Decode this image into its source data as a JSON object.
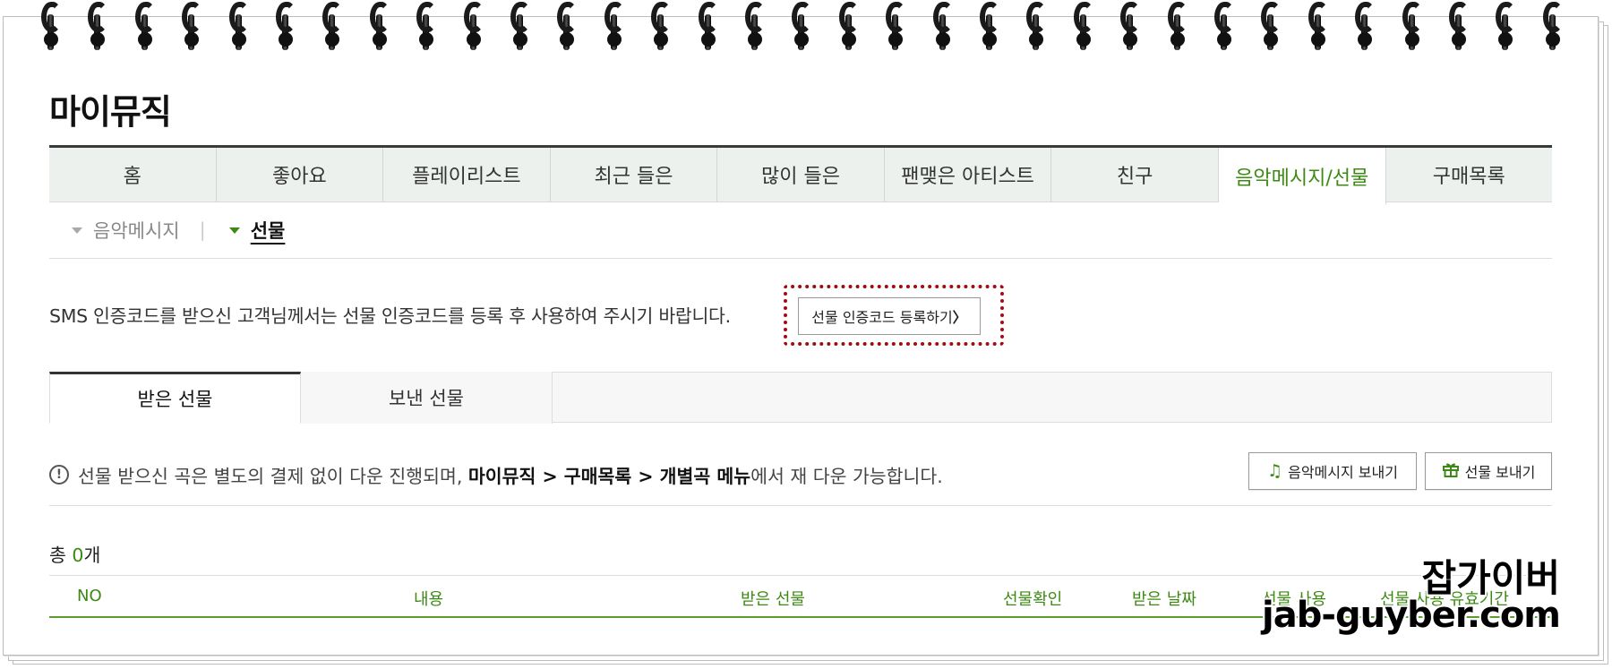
{
  "page": {
    "title": "마이뮤직"
  },
  "main_tabs": [
    {
      "label": "홈"
    },
    {
      "label": "좋아요"
    },
    {
      "label": "플레이리스트"
    },
    {
      "label": "최근 들은"
    },
    {
      "label": "많이 들은"
    },
    {
      "label": "팬맺은 아티스트"
    },
    {
      "label": "친구"
    },
    {
      "label": "음악메시지/선물"
    },
    {
      "label": "구매목록"
    }
  ],
  "sub_nav": {
    "message": "음악메시지",
    "separator": "|",
    "gift": "선물"
  },
  "sms": {
    "text": "SMS 인증코드를 받으신 고객님께서는 선물 인증코드를 등록 후 사용하여 주시기 바랍니다.",
    "register_button": "선물 인증코드 등록하기",
    "register_arrow": "〉"
  },
  "gift_tabs": {
    "received": "받은 선물",
    "sent": "보낸 선물"
  },
  "notice": {
    "icon": "!",
    "prefix": "선물 받으신 곡은 별도의 결제 없이 다운 진행되며,",
    "path": "마이뮤직 > 구매목록 > 개별곡 메뉴",
    "suffix": "에서 재 다운 가능합니다."
  },
  "buttons": {
    "send_message": "음악메시지 보내기",
    "send_gift": "선물 보내기",
    "music_icon": "music-note-icon",
    "gift_icon": "gift-icon",
    "accent_color": "#3c8a13"
  },
  "total": {
    "prefix": "총",
    "count": "0",
    "suffix": "개"
  },
  "table_headers": {
    "no": "NO",
    "content": "내용",
    "received_gift": "받은 선물",
    "confirm": "선물확인",
    "received_date": "받은 날짜",
    "use": "선물 사용",
    "expiry": "선물 사용 유효기간"
  },
  "watermark": {
    "korean": "잡가이버",
    "url": "jab-guyber.com"
  }
}
